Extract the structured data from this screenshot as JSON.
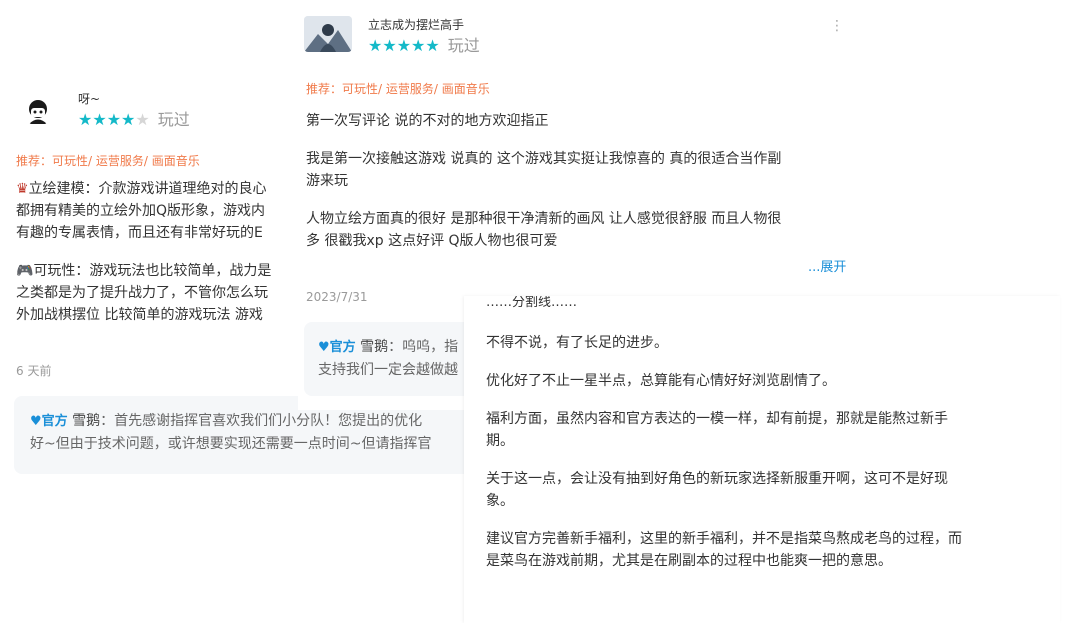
{
  "colors": {
    "accent": "#14b9c8",
    "recommend": "#f07a4a",
    "official": "#1a8fd8"
  },
  "review_left": {
    "username": "呀~",
    "rating": 4,
    "stars": [
      1,
      1,
      1,
      1,
      0
    ],
    "played": "玩过",
    "recommend": "推荐：可玩性/ 运营服务/ 画面音乐",
    "para1_lines": [
      "立绘建模：介款游戏讲道理绝对的良心",
      "都拥有精美的立绘外加Q版形象，游戏内",
      "有趣的专属表情，而且还有非常好玩的E"
    ],
    "para2_lines": [
      "可玩性：游戏玩法也比较简单，战力是",
      "之类都是为了提升战力了，不管你怎么玩",
      "外加战棋摆位 比较简单的游戏玩法 游戏"
    ],
    "time": "6 天前",
    "reply": {
      "badge": "官方",
      "name": "雪鹅",
      "lines": [
        "：首先感谢指挥官喜欢我们们小分队！您提出的优化",
        "好~但由于技术问题，或许想要实现还需要一点时间~但请指挥官"
      ]
    }
  },
  "review_top": {
    "username": "立志成为摆烂高手",
    "rating": 5,
    "stars": [
      1,
      1,
      1,
      1,
      1
    ],
    "played": "玩过",
    "more": "⋮",
    "recommend": "推荐：可玩性/ 运营服务/ 画面音乐",
    "line1": "第一次写评论 说的不对的地方欢迎指正",
    "para2_lines": [
      "我是第一次接触这游戏 说真的 这个游戏其实挺让我惊喜的 真的很适合当作副",
      "游来玩"
    ],
    "para3_lines": [
      "人物立绘方面真的很好 是那种很干净清新的画风 让人感觉很舒服 而且人物很",
      "多 很戳我xp 这点好评 Q版人物也很可爱"
    ],
    "expand": "...展开",
    "date": "2023/7/31",
    "reply": {
      "badge": "官方",
      "name": "雪鹅",
      "lines": [
        "：呜呜，指",
        "支持我们一定会越做越"
      ]
    }
  },
  "review_right": {
    "lines": [
      "……分割线……",
      "不得不说，有了长足的进步。",
      "优化好了不止一星半点，总算能有心情好好浏览剧情了。",
      "福利方面，虽然内容和官方表达的一模一样，却有前提，那就是能熬过新手",
      "期。",
      "关于这一点，会让没有抽到好角色的新玩家选择新服重开啊，这可不是好现",
      "象。",
      "建议官方完善新手福利，这里的新手福利，并不是指菜鸟熬成老鸟的过程，而",
      "是菜鸟在游戏前期，尤其是在刷副本的过程中也能爽一把的意思。"
    ]
  }
}
